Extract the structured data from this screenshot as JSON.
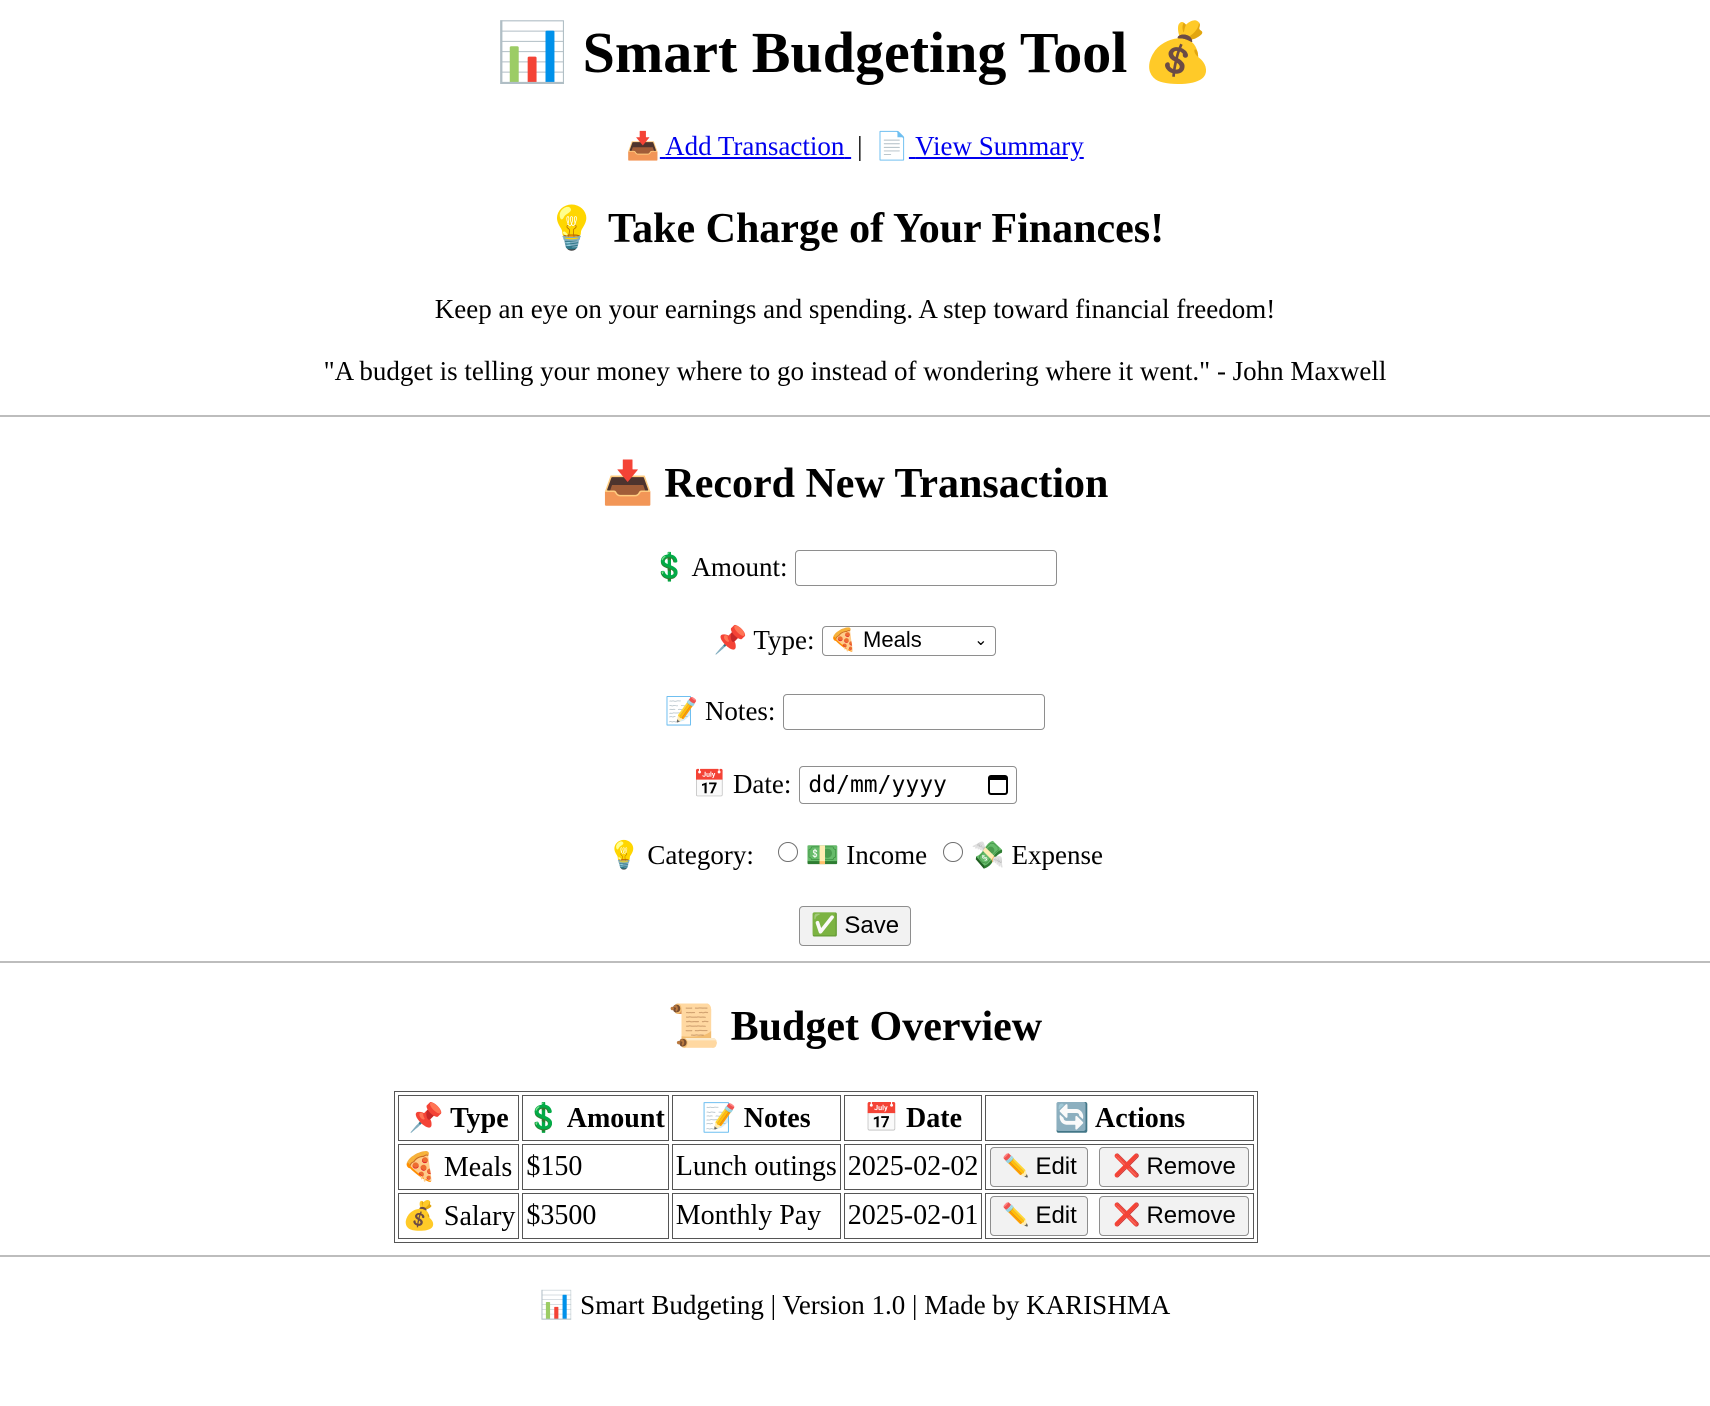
{
  "header": {
    "title_icon": "📊",
    "title": "Smart Budgeting Tool",
    "title_icon_end": "💰"
  },
  "nav": {
    "add_icon": "📥",
    "add_label": "Add Transaction",
    "separator": "|",
    "summary_icon": "📄",
    "summary_label": "View Summary"
  },
  "intro": {
    "icon": "💡",
    "title": "Take Charge of Your Finances!",
    "tagline": "Keep an eye on your earnings and spending. A step toward financial freedom!",
    "quote": "\"A budget is telling your money where to go instead of wondering where it went.\" - John Maxwell"
  },
  "form": {
    "icon": "📥",
    "title": "Record New Transaction",
    "amount_icon": "💲",
    "amount_label": "Amount:",
    "amount_value": "",
    "type_icon": "📌",
    "type_label": "Type:",
    "type_selected_icon": "🍕",
    "type_selected": "Meals",
    "notes_icon": "📝",
    "notes_label": "Notes:",
    "notes_value": "",
    "date_icon": "📅",
    "date_label": "Date:",
    "date_placeholder": "dd/mm/yyyy",
    "category_icon": "💡",
    "category_label": "Category:",
    "income_icon": "💵",
    "income_label": "Income",
    "expense_icon": "💸",
    "expense_label": "Expense",
    "save_icon": "✅",
    "save_label": "Save"
  },
  "overview": {
    "icon": "📜",
    "title": "Budget Overview",
    "columns": [
      {
        "icon": "📌",
        "label": "Type"
      },
      {
        "icon": "💲",
        "label": "Amount"
      },
      {
        "icon": "📝",
        "label": "Notes"
      },
      {
        "icon": "📅",
        "label": "Date"
      },
      {
        "icon": "🔄",
        "label": "Actions"
      }
    ],
    "rows": [
      {
        "type_icon": "🍕",
        "type": "Meals",
        "amount": "$150",
        "notes": "Lunch outings",
        "date": "2025-02-02"
      },
      {
        "type_icon": "💰",
        "type": "Salary",
        "amount": "$3500",
        "notes": "Monthly Pay",
        "date": "2025-02-01"
      }
    ],
    "edit_icon": "✏️",
    "edit_label": "Edit",
    "remove_icon": "❌",
    "remove_label": "Remove"
  },
  "footer": {
    "icon": "📊",
    "text": "Smart Budgeting | Version 1.0 | Made by KARISHMA"
  },
  "colors": {
    "link": "#0000ee",
    "remove_x": "#e0201b",
    "divider": "#bdbdbd"
  }
}
